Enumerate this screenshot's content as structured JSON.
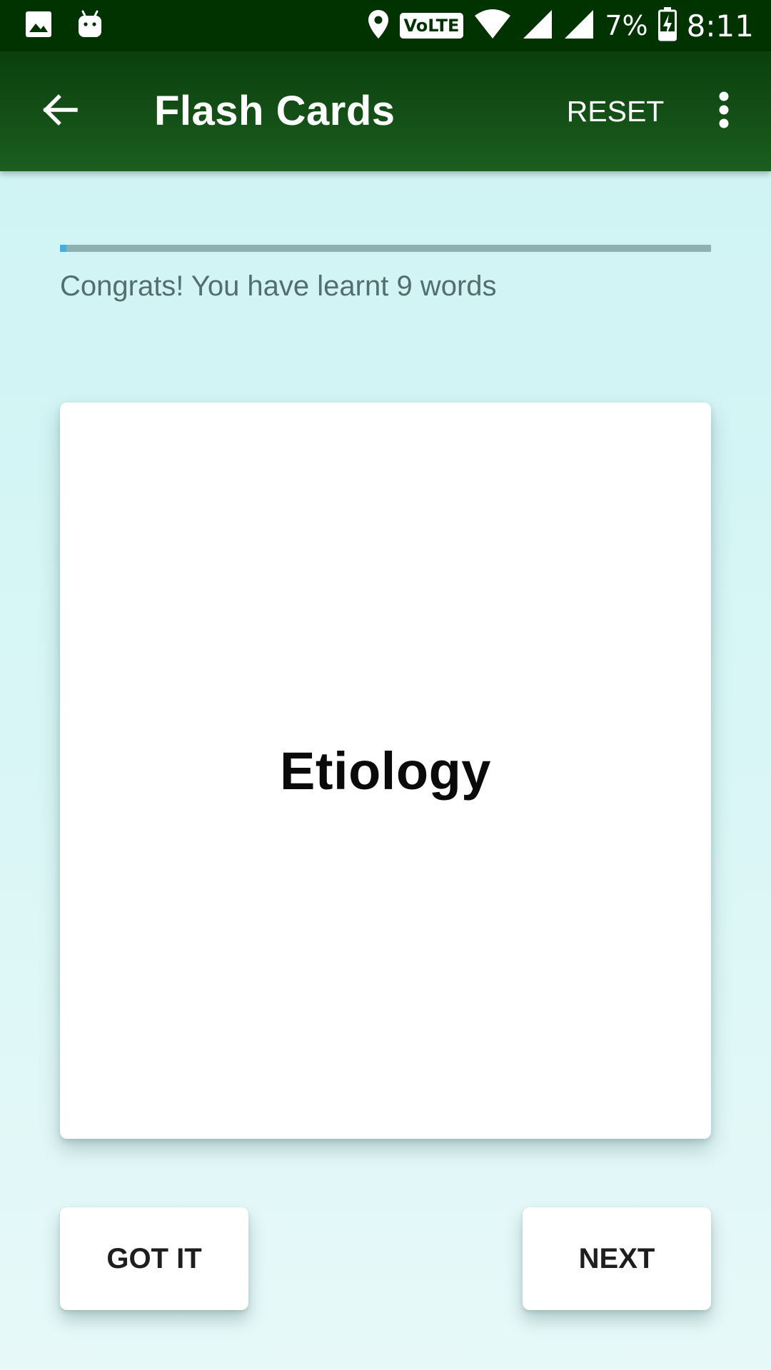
{
  "status_bar": {
    "battery_percent": "7%",
    "time": "8:11",
    "network_badge": "VoLTE",
    "icons": [
      "image-icon",
      "android-icon",
      "location-icon",
      "volte-icon",
      "wifi-icon",
      "signal-icon",
      "signal-icon",
      "battery-charging-icon"
    ]
  },
  "app_bar": {
    "title": "Flash Cards",
    "reset_label": "RESET",
    "back_icon": "arrow-left-icon",
    "overflow_icon": "more-vert-icon"
  },
  "progress": {
    "fraction": 0.01,
    "message": "Congrats! You have learnt 9 words"
  },
  "card": {
    "word": "Etiology"
  },
  "buttons": {
    "got_it": "GOT IT",
    "next": "NEXT"
  },
  "colors": {
    "status_bar": "#003300",
    "app_bar": "#1b5e20",
    "background": "#d9f6f6",
    "progress_fill": "#3fb0e0",
    "progress_track": "#8fb0b0"
  }
}
